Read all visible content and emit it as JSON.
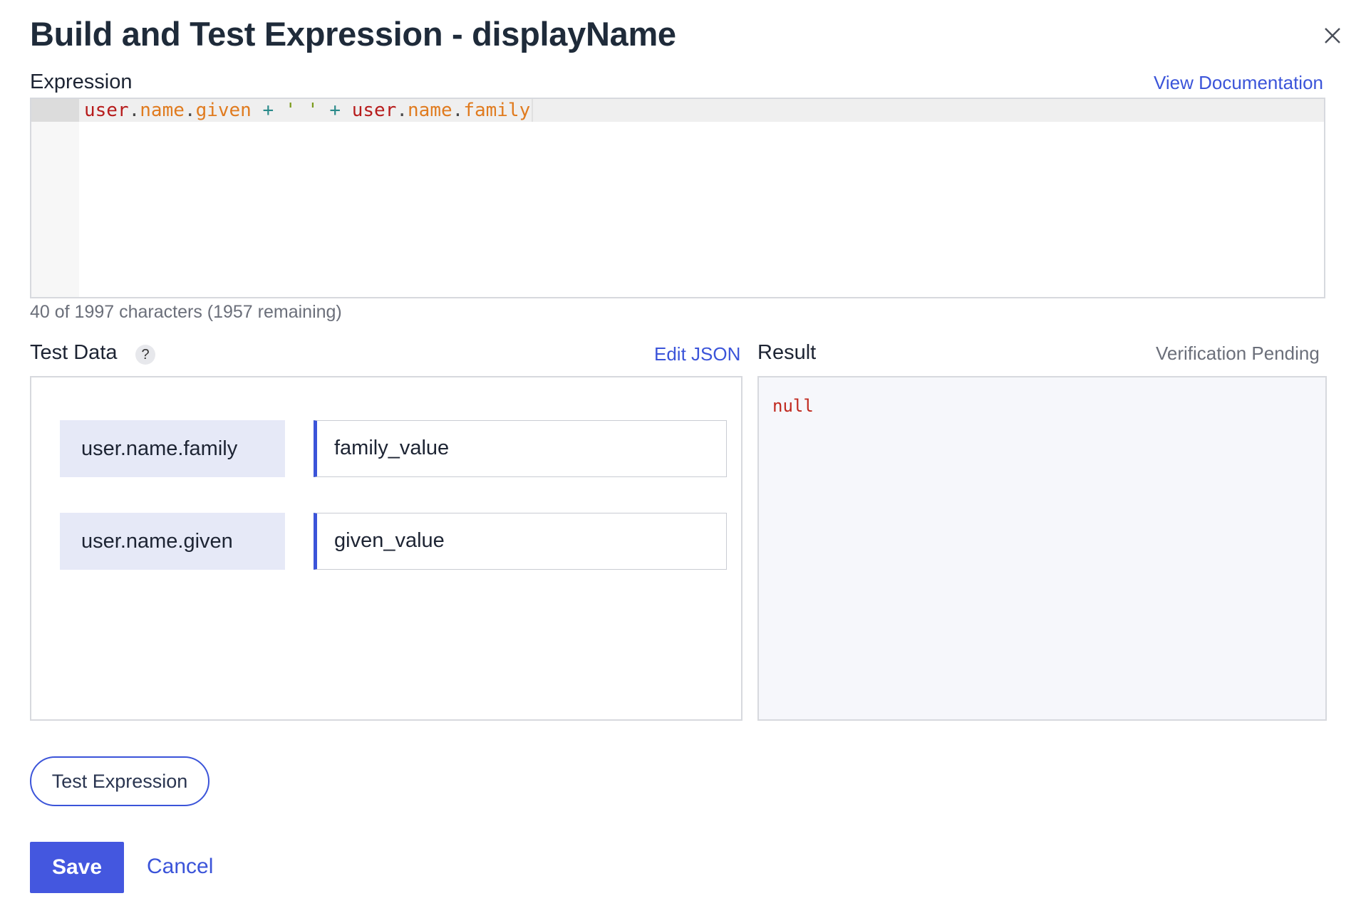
{
  "dialog": {
    "title": "Build and Test Expression - displayName",
    "close_icon": "close-icon"
  },
  "expression": {
    "label": "Expression",
    "doc_link": "View Documentation",
    "code_tokens": [
      {
        "text": "user",
        "kind": "var"
      },
      {
        "text": ".",
        "kind": "dot"
      },
      {
        "text": "name",
        "kind": "prop"
      },
      {
        "text": ".",
        "kind": "dot"
      },
      {
        "text": "given",
        "kind": "prop"
      },
      {
        "text": " + ",
        "kind": "op"
      },
      {
        "text": "' '",
        "kind": "str"
      },
      {
        "text": " + ",
        "kind": "op"
      },
      {
        "text": "user",
        "kind": "var"
      },
      {
        "text": ".",
        "kind": "dot"
      },
      {
        "text": "name",
        "kind": "prop"
      },
      {
        "text": ".",
        "kind": "dot"
      },
      {
        "text": "family",
        "kind": "prop"
      }
    ],
    "counter": "40 of 1997 characters (1957 remaining)"
  },
  "test_data": {
    "label": "Test Data",
    "help_glyph": "?",
    "edit_link": "Edit JSON",
    "rows": [
      {
        "key": "user.name.family",
        "value": "family_value"
      },
      {
        "key": "user.name.given",
        "value": "given_value"
      }
    ]
  },
  "result": {
    "label": "Result",
    "status": "Verification Pending",
    "value": "null"
  },
  "actions": {
    "test_label": "Test Expression",
    "save_label": "Save",
    "cancel_label": "Cancel"
  },
  "colors": {
    "accent": "#3b54d9",
    "save_bg": "#4457df",
    "key_bg": "#e6e9f7",
    "result_bg": "#f6f7fb",
    "null_text": "#c0291f"
  }
}
